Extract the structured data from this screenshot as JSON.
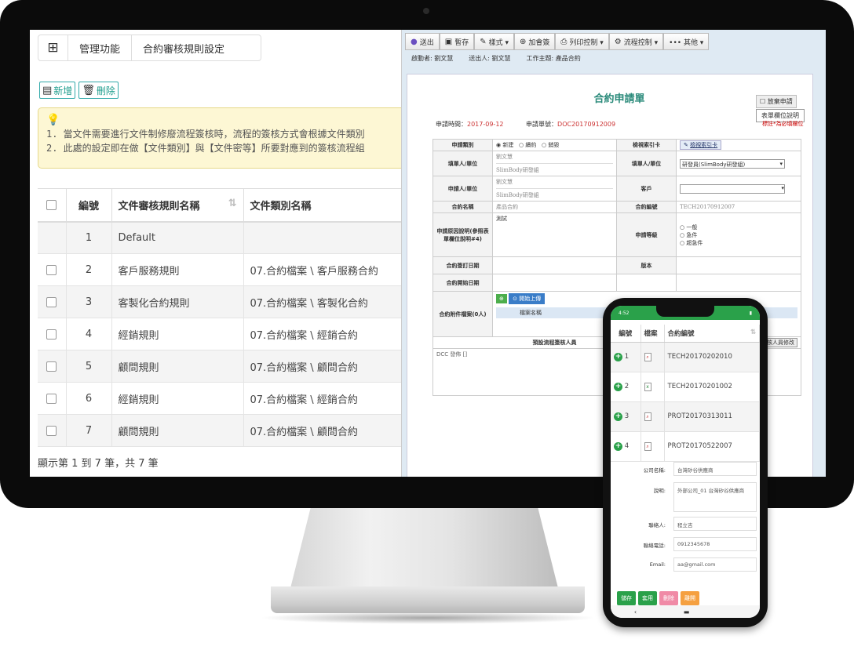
{
  "left": {
    "breadcrumb": [
      "管理功能",
      "合約審核規則設定"
    ],
    "toolbar": {
      "add_label": "新增",
      "delete_label": "刪除"
    },
    "note": {
      "line1": "1. 當文件需要進行文件制修廢流程簽核時，流程的簽核方式會根據文件類別",
      "line2": "2. 此處的設定即在做【文件類別】與【文件密等】所要對應到的簽核流程組"
    },
    "table": {
      "headers": [
        "編號",
        "文件審核規則名稱",
        "文件類別名稱"
      ],
      "rows": [
        {
          "no": "1",
          "name": "Default",
          "category": ""
        },
        {
          "no": "2",
          "name": "客戶服務規則",
          "category": "07.合約檔案 \\ 客戶服務合約"
        },
        {
          "no": "3",
          "name": "客製化合約規則",
          "category": "07.合約檔案 \\ 客製化合約"
        },
        {
          "no": "4",
          "name": "經銷規則",
          "category": "07.合約檔案 \\ 經銷合約"
        },
        {
          "no": "5",
          "name": "顧問規則",
          "category": "07.合約檔案 \\ 顧問合約"
        },
        {
          "no": "6",
          "name": "經銷規則",
          "category": "07.合約檔案 \\ 經銷合約"
        },
        {
          "no": "7",
          "name": "顧問規則",
          "category": "07.合約檔案 \\ 顧問合約"
        }
      ]
    },
    "footer": "顯示第 1 到 7 筆，共 7 筆"
  },
  "right": {
    "toolbar": [
      "送出",
      "暫存",
      "樣式 ▾",
      "加會簽",
      "列印控制 ▾",
      "流程控制 ▾",
      "••• 其他 ▾"
    ],
    "meta": {
      "initiator": "啟動者: 劉文慧",
      "sender": "送出人: 劉文慧",
      "subject": "工作主題: 產品合約"
    },
    "title": "合約申請單",
    "checkbox_label": "放棄申請",
    "desc_button": "表單欄位說明",
    "required_note": "標註*為必填欄位",
    "apply_time_label": "申請時間：",
    "apply_time": "2017-09-12",
    "form_no_label": "申請單號：",
    "form_no": "DOC20170912009",
    "fields": {
      "category_label": "申請類別",
      "category_opts": [
        "新建",
        "續約",
        "銷毀"
      ],
      "index_label": "檢視索引卡",
      "index_btn": "檢視索引卡",
      "filler_label": "填單人/單位",
      "filler_name": "劉文慧",
      "filler_unit": "SlimBody研發組",
      "filler_unit2_label": "填單人/單位",
      "filler_unit2_value": "研發員(SlimBody研發組)",
      "applicant_label": "申請人/單位",
      "applicant_name": "劉文慧",
      "applicant_unit": "SlimBody研發組",
      "customer_label": "客戶",
      "contract_name_label": "合約名稱",
      "contract_name": "產品合約",
      "contract_no_label": "合約編號",
      "contract_no": "TECH20170912007",
      "reason_label": "申請原因說明(參照表單欄位說明#4)",
      "reason_value": "測試",
      "level_label": "申請等級",
      "level_opts": [
        "一般",
        "急件",
        "超急件"
      ],
      "sign_date_label": "合約簽訂日期",
      "version_label": "版本",
      "start_date_label": "合約開始日期",
      "attach_label": "合約附件檔案(0人)",
      "upload_btn": "開始上傳",
      "file_col": "檔案名稱",
      "reviewer_label": "預設流程簽核人員",
      "reviewer_btn": "審核人員修改",
      "dcc": "DCC 發佈 []"
    }
  },
  "phone": {
    "status_time": "4:52",
    "headers": [
      "編號",
      "檔案",
      "合約編號"
    ],
    "rows": [
      {
        "no": "1",
        "file": "pdf",
        "code": "TECH20170202010"
      },
      {
        "no": "2",
        "file": "xls",
        "code": "TECH20170201002"
      },
      {
        "no": "3",
        "file": "pdf",
        "code": "PROT20170313011"
      },
      {
        "no": "4",
        "file": "pdf",
        "code": "PROT20170522007"
      }
    ],
    "form": {
      "company_label": "公司名稱:",
      "company": "台灣矽谷供應商",
      "desc_label": "說明:",
      "desc": "外部公司_01 台灣矽谷供應商",
      "contact_label": "聯絡人:",
      "contact": "程立吉",
      "phone_label": "聯絡電話:",
      "phone": "0912345678",
      "email_label": "Email:",
      "email": "aa@gmail.com"
    },
    "buttons": [
      "儲存",
      "套用",
      "刪除",
      "離開"
    ]
  }
}
